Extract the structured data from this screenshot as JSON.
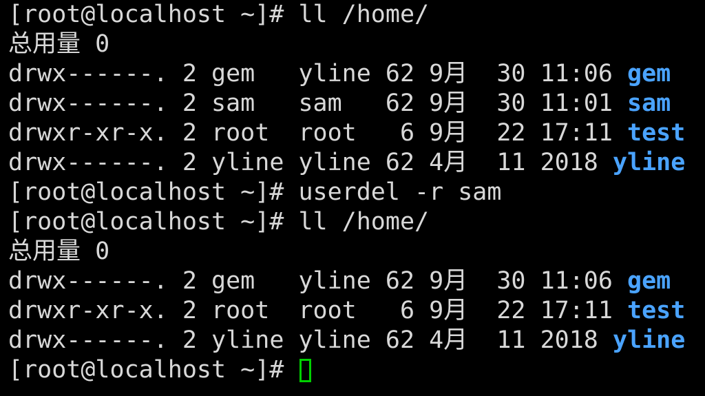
{
  "terminal": {
    "colors": {
      "background": "#000000",
      "text": "#d8d8d8",
      "directory": "#4aa3ff",
      "cursor": "#00d000"
    },
    "lines": {
      "l0": {
        "prompt": "[root@localhost ~]# ",
        "command": "ll /home/"
      },
      "l1": {
        "text": "总用量 0"
      },
      "l2": {
        "perm": "drwx------.",
        "links": "2",
        "owner": "gem  ",
        "group": "yline",
        "size": "62",
        "date": "9月  30 11:06",
        "name": "gem"
      },
      "l3": {
        "perm": "drwx------.",
        "links": "2",
        "owner": "sam  ",
        "group": "sam  ",
        "size": "62",
        "date": "9月  30 11:01",
        "name": "sam"
      },
      "l4": {
        "perm": "drwxr-xr-x.",
        "links": "2",
        "owner": "root ",
        "group": "root ",
        "size": " 6",
        "date": "9月  22 17:11",
        "name": "test"
      },
      "l5": {
        "perm": "drwx------.",
        "links": "2",
        "owner": "yline",
        "group": "yline",
        "size": "62",
        "date": "4月  11 2018",
        "name": "yline"
      },
      "l6": {
        "prompt": "[root@localhost ~]# ",
        "command": "userdel -r sam"
      },
      "l7": {
        "prompt": "[root@localhost ~]# ",
        "command": "ll /home/"
      },
      "l8": {
        "text": "总用量 0"
      },
      "l9": {
        "perm": "drwx------.",
        "links": "2",
        "owner": "gem  ",
        "group": "yline",
        "size": "62",
        "date": "9月  30 11:06",
        "name": "gem"
      },
      "l10": {
        "perm": "drwxr-xr-x.",
        "links": "2",
        "owner": "root ",
        "group": "root ",
        "size": " 6",
        "date": "9月  22 17:11",
        "name": "test"
      },
      "l11": {
        "perm": "drwx------.",
        "links": "2",
        "owner": "yline",
        "group": "yline",
        "size": "62",
        "date": "4月  11 2018",
        "name": "yline"
      },
      "l12": {
        "prompt": "[root@localhost ~]# ",
        "command": ""
      }
    }
  }
}
